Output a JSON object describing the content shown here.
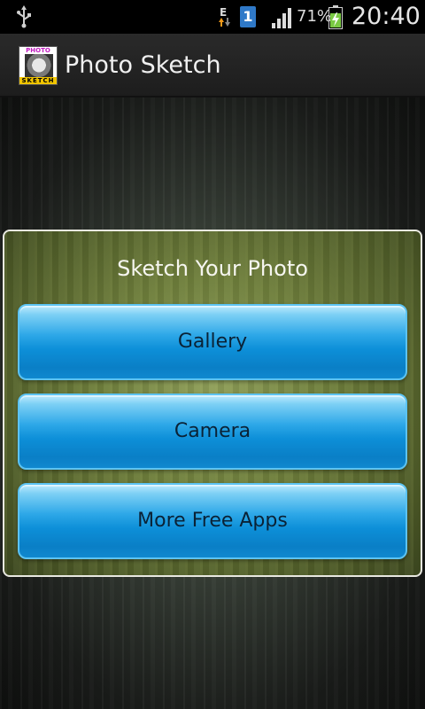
{
  "status_bar": {
    "network_type": "E",
    "notification_count": "1",
    "battery_percent": "71%",
    "time": "20:40",
    "icons": [
      "usb-icon",
      "network-data-icon",
      "notification-icon",
      "signal-icon",
      "battery-charging-icon"
    ]
  },
  "title_bar": {
    "app_title": "Photo Sketch",
    "icon_top_text": "PHOTO",
    "icon_bottom_text": "SKETCH"
  },
  "panel": {
    "heading": "Sketch Your Photo",
    "buttons": [
      {
        "label": "Gallery"
      },
      {
        "label": "Camera"
      },
      {
        "label": "More Free Apps"
      }
    ]
  },
  "colors": {
    "button_blue": "#0d8fd8",
    "panel_green": "#6f7f3c",
    "status_bar": "#000000"
  }
}
